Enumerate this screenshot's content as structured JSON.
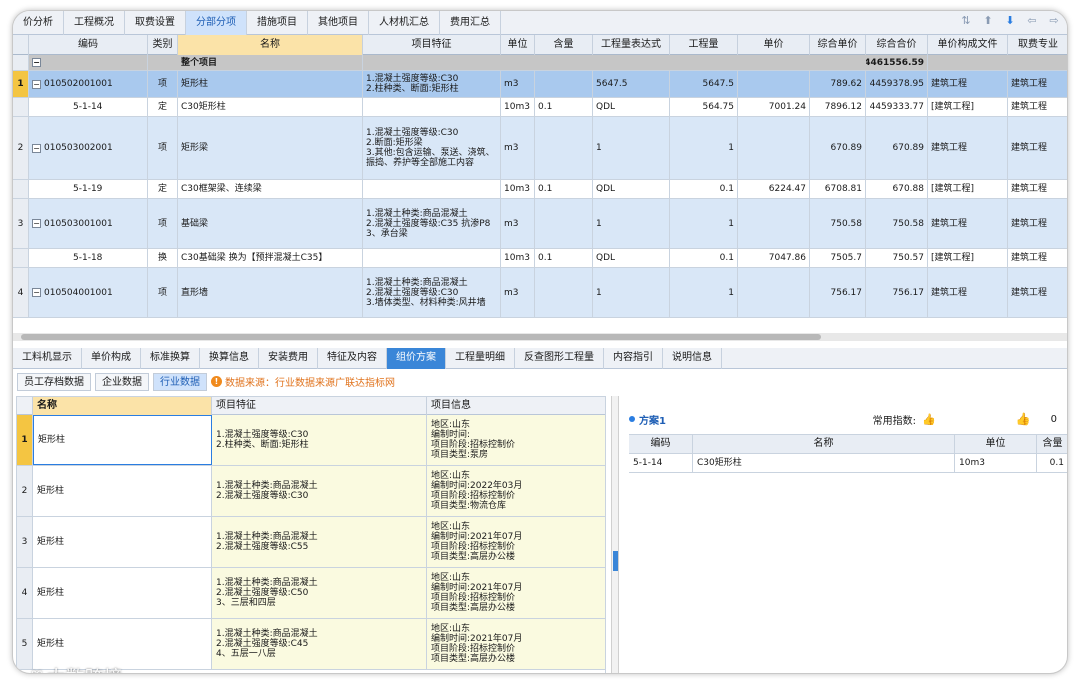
{
  "top_tabs": [
    "价分析",
    "工程概况",
    "取费设置",
    "分部分项",
    "措施项目",
    "其他项目",
    "人材机汇总",
    "费用汇总"
  ],
  "top_tabs_active": 3,
  "columns": [
    "编码",
    "类别",
    "名称",
    "项目特征",
    "单位",
    "含量",
    "工程量表达式",
    "工程量",
    "单价",
    "综合单价",
    "综合合价",
    "单价构成文件",
    "取费专业"
  ],
  "total_row": {
    "name": "整个项目",
    "amount": "4461556.59"
  },
  "rows": [
    {
      "idx": "1",
      "kind": "q",
      "code": "010502001001",
      "type": "项",
      "name": "矩形柱",
      "feature": "1.混凝土强度等级:C30\n2.柱种类、断面:矩形柱",
      "unit": "m3",
      "content": "",
      "expr": "5647.5",
      "qty": "5647.5",
      "price": "",
      "uprice": "789.62",
      "total": "4459378.95",
      "file": "建筑工程",
      "spec": "建筑工程"
    },
    {
      "idx": "",
      "kind": "d",
      "code": "5-1-14",
      "type": "定",
      "name": "C30矩形柱",
      "feature": "",
      "unit": "10m3",
      "content": "0.1",
      "expr": "QDL",
      "qty": "564.75",
      "price": "7001.24",
      "uprice": "7896.12",
      "total": "4459333.77",
      "file": "[建筑工程]",
      "spec": "建筑工程"
    },
    {
      "idx": "2",
      "kind": "q",
      "code": "010503002001",
      "type": "项",
      "name": "矩形梁",
      "feature": "1.混凝土强度等级:C30\n2.断面:矩形梁\n3.其他:包含运输、泵送、浇筑、振捣、养护等全部施工内容",
      "unit": "m3",
      "content": "",
      "expr": "1",
      "qty": "1",
      "price": "",
      "uprice": "670.89",
      "total": "670.89",
      "file": "建筑工程",
      "spec": "建筑工程"
    },
    {
      "idx": "",
      "kind": "d",
      "code": "5-1-19",
      "type": "定",
      "name": "C30框架梁、连续梁",
      "feature": "",
      "unit": "10m3",
      "content": "0.1",
      "expr": "QDL",
      "qty": "0.1",
      "price": "6224.47",
      "uprice": "6708.81",
      "total": "670.88",
      "file": "[建筑工程]",
      "spec": "建筑工程"
    },
    {
      "idx": "3",
      "kind": "q",
      "code": "010503001001",
      "type": "项",
      "name": "基础梁",
      "feature": "1.混凝土种类:商品混凝土\n2.混凝土强度等级:C35 抗渗P8\n3、承台梁",
      "unit": "m3",
      "content": "",
      "expr": "1",
      "qty": "1",
      "price": "",
      "uprice": "750.58",
      "total": "750.58",
      "file": "建筑工程",
      "spec": "建筑工程"
    },
    {
      "idx": "",
      "kind": "d",
      "code": "5-1-18",
      "type": "换",
      "name": "C30基础梁  换为【预拌混凝土C35】",
      "feature": "",
      "unit": "10m3",
      "content": "0.1",
      "expr": "QDL",
      "qty": "0.1",
      "price": "7047.86",
      "uprice": "7505.7",
      "total": "750.57",
      "file": "[建筑工程]",
      "spec": "建筑工程"
    },
    {
      "idx": "4",
      "kind": "q",
      "code": "010504001001",
      "type": "项",
      "name": "直形墙",
      "feature": "1.混凝土种类:商品混凝土\n2.混凝土强度等级:C30\n3.墙体类型、材料种类:风井墙",
      "unit": "m3",
      "content": "",
      "expr": "1",
      "qty": "1",
      "price": "",
      "uprice": "756.17",
      "total": "756.17",
      "file": "建筑工程",
      "spec": "建筑工程"
    }
  ],
  "mid_tabs": [
    "工料机显示",
    "单价构成",
    "标准换算",
    "换算信息",
    "安装费用",
    "特征及内容",
    "组价方案",
    "工程量明细",
    "反查图形工程量",
    "内容指引",
    "说明信息"
  ],
  "mid_tabs_active": 6,
  "source_tabs": [
    "员工存档数据",
    "企业数据",
    "行业数据"
  ],
  "source_tabs_active": 2,
  "source_note": "数据来源：行业数据来源广联达指标网",
  "lower_columns": [
    "名称",
    "项目特征",
    "项目信息"
  ],
  "lower_rows": [
    {
      "idx": "1",
      "name": "矩形柱",
      "feature": "1.混凝土强度等级:C30\n2.柱种类、断面:矩形柱",
      "info": "地区:山东\n编制时间:\n项目阶段:招标控制价\n项目类型:泵房"
    },
    {
      "idx": "2",
      "name": "矩形柱",
      "feature": "1.混凝土种类:商品混凝土\n2.混凝土强度等级:C30",
      "info": "地区:山东\n编制时间:2022年03月\n项目阶段:招标控制价\n项目类型:物流仓库"
    },
    {
      "idx": "3",
      "name": "矩形柱",
      "feature": "1.混凝土种类:商品混凝土\n2.混凝土强度等级:C55",
      "info": "地区:山东\n编制时间:2021年07月\n项目阶段:招标控制价\n项目类型:高层办公楼"
    },
    {
      "idx": "4",
      "name": "矩形柱",
      "feature": "1.混凝土种类:商品混凝土\n2.混凝土强度等级:C50\n3、三层和四层",
      "info": "地区:山东\n编制时间:2021年07月\n项目阶段:招标控制价\n项目类型:高层办公楼"
    },
    {
      "idx": "5",
      "name": "矩形柱",
      "feature": "1.混凝土种类:商品混凝土\n2.混凝土强度等级:C45\n4、五层一八层",
      "info": "地区:山东\n编制时间:2021年07月\n项目阶段:招标控制价\n项目类型:高层办公楼"
    }
  ],
  "plan": {
    "name": "方案1",
    "freq_label": "常用指数:",
    "likes": "0"
  },
  "plan_columns": [
    "编码",
    "名称",
    "单位",
    "含量"
  ],
  "plan_rows": [
    {
      "code": "5-1-14",
      "name": "C30矩形柱",
      "unit": "10m3",
      "content": "0.1"
    }
  ],
  "watermark": "大数跨境",
  "icons": {
    "sort": "sort-icon",
    "up": "arrow-up-icon",
    "down": "arrow-down-icon"
  },
  "colors": {
    "active_tab": "#3a86d8",
    "quota_row": "#d9e7f7",
    "selected_row": "#a9c9ee",
    "name_header": "#fbe3a8"
  }
}
